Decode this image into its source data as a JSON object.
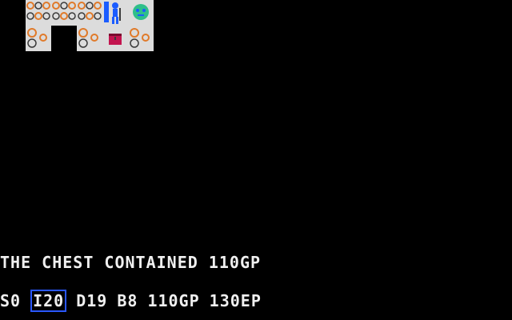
{
  "message": "THE CHEST CONTAINED 110GP",
  "stats": {
    "s": "S0",
    "i": "I20",
    "d": "D19",
    "b": "B8",
    "gold": "110GP",
    "exp": "130EP"
  },
  "icons": {
    "wall": "rock-wall-icon",
    "door": "doorway-icon",
    "hero": "adventurer-icon",
    "monster": "green-face-monster-icon",
    "chest": "treasure-chest-icon"
  },
  "colors": {
    "wall": "#dcdcdc",
    "rock": "#e07a2a",
    "hero": "#1b5cff",
    "monster": "#2fbf8a",
    "chest": "#c3144f",
    "text": "#f0f0f0",
    "highlight": "#2a57ff"
  }
}
